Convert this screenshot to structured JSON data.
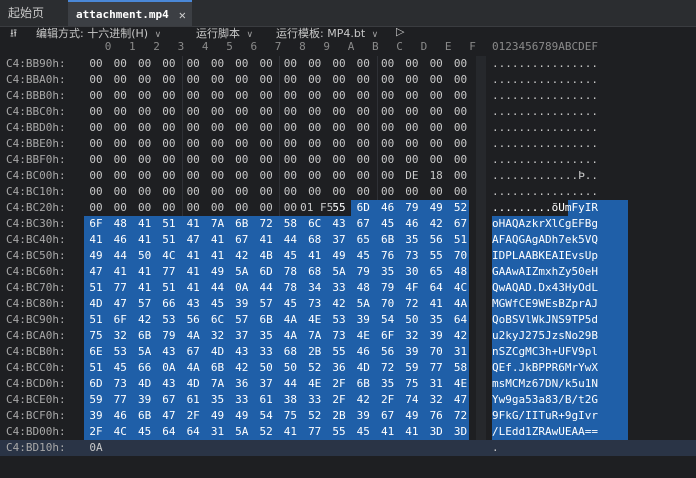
{
  "tabs": [
    {
      "label": "起始页",
      "active": false
    },
    {
      "label": "attachment.mp4",
      "active": true,
      "close": "✕"
    }
  ],
  "toolbar": {
    "pin_icon": "pin-icon",
    "edit_mode_label": "编辑方式:",
    "edit_mode_value": "十六进制(H)",
    "run_script": "运行脚本",
    "run_template_label": "运行模板:",
    "run_template_value": "MP4.bt",
    "play": "▷"
  },
  "header": {
    "columns": [
      "0",
      "1",
      "2",
      "3",
      "4",
      "5",
      "6",
      "7",
      "8",
      "9",
      "A",
      "B",
      "C",
      "D",
      "E",
      "F"
    ],
    "ascii": "0123456789ABCDEF"
  },
  "rows": [
    {
      "addr": "C4:BB90h:",
      "bytes": [
        "00",
        "00",
        "00",
        "00",
        "00",
        "00",
        "00",
        "00",
        "00",
        "00",
        "00",
        "00",
        "00",
        "00",
        "00",
        "00"
      ],
      "ascii": "................"
    },
    {
      "addr": "C4:BBA0h:",
      "bytes": [
        "00",
        "00",
        "00",
        "00",
        "00",
        "00",
        "00",
        "00",
        "00",
        "00",
        "00",
        "00",
        "00",
        "00",
        "00",
        "00"
      ],
      "ascii": "................"
    },
    {
      "addr": "C4:BBB0h:",
      "bytes": [
        "00",
        "00",
        "00",
        "00",
        "00",
        "00",
        "00",
        "00",
        "00",
        "00",
        "00",
        "00",
        "00",
        "00",
        "00",
        "00"
      ],
      "ascii": "................"
    },
    {
      "addr": "C4:BBC0h:",
      "bytes": [
        "00",
        "00",
        "00",
        "00",
        "00",
        "00",
        "00",
        "00",
        "00",
        "00",
        "00",
        "00",
        "00",
        "00",
        "00",
        "00"
      ],
      "ascii": "................"
    },
    {
      "addr": "C4:BBD0h:",
      "bytes": [
        "00",
        "00",
        "00",
        "00",
        "00",
        "00",
        "00",
        "00",
        "00",
        "00",
        "00",
        "00",
        "00",
        "00",
        "00",
        "00"
      ],
      "ascii": "................"
    },
    {
      "addr": "C4:BBE0h:",
      "bytes": [
        "00",
        "00",
        "00",
        "00",
        "00",
        "00",
        "00",
        "00",
        "00",
        "00",
        "00",
        "00",
        "00",
        "00",
        "00",
        "00"
      ],
      "ascii": "................"
    },
    {
      "addr": "C4:BBF0h:",
      "bytes": [
        "00",
        "00",
        "00",
        "00",
        "00",
        "00",
        "00",
        "00",
        "00",
        "00",
        "00",
        "00",
        "00",
        "00",
        "00",
        "00"
      ],
      "ascii": "................"
    },
    {
      "addr": "C4:BC00h:",
      "bytes": [
        "00",
        "00",
        "00",
        "00",
        "00",
        "00",
        "00",
        "00",
        "00",
        "00",
        "00",
        "00",
        "00",
        "DE",
        "18",
        "00"
      ],
      "ascii": ".............Þ.."
    },
    {
      "addr": "C4:BC10h:",
      "bytes": [
        "00",
        "00",
        "00",
        "00",
        "00",
        "00",
        "00",
        "00",
        "00",
        "00",
        "00",
        "00",
        "00",
        "00",
        "00",
        "00"
      ],
      "ascii": "................"
    },
    {
      "addr": "C4:BC20h:",
      "bytes": [
        "00",
        "00",
        "00",
        "00",
        "00",
        "00",
        "00",
        "00",
        "00",
        "01",
        "F5",
        "55",
        "6D",
        "46",
        "79",
        "49",
        "52"
      ],
      "ascii": ".........õUmFyIR"
    },
    {
      "addr": "C4:BC30h:",
      "bytes": [
        "6F",
        "48",
        "41",
        "51",
        "41",
        "7A",
        "6B",
        "72",
        "58",
        "6C",
        "43",
        "67",
        "45",
        "46",
        "42",
        "67"
      ],
      "ascii": "oHAQAzkrXlCgEFBg"
    },
    {
      "addr": "C4:BC40h:",
      "bytes": [
        "41",
        "46",
        "41",
        "51",
        "47",
        "41",
        "67",
        "41",
        "44",
        "68",
        "37",
        "65",
        "6B",
        "35",
        "56",
        "51"
      ],
      "ascii": "AFAQGAgADh7ek5VQ"
    },
    {
      "addr": "C4:BC50h:",
      "bytes": [
        "49",
        "44",
        "50",
        "4C",
        "41",
        "41",
        "42",
        "4B",
        "45",
        "41",
        "49",
        "45",
        "76",
        "73",
        "55",
        "70"
      ],
      "ascii": "IDPLAABKEAIEvsUp"
    },
    {
      "addr": "C4:BC60h:",
      "bytes": [
        "47",
        "41",
        "41",
        "77",
        "41",
        "49",
        "5A",
        "6D",
        "78",
        "68",
        "5A",
        "79",
        "35",
        "30",
        "65",
        "48"
      ],
      "ascii": "GAAwAIZmxhZy50eH"
    },
    {
      "addr": "C4:BC70h:",
      "bytes": [
        "51",
        "77",
        "41",
        "51",
        "41",
        "44",
        "0A",
        "44",
        "78",
        "34",
        "33",
        "48",
        "79",
        "4F",
        "64",
        "4C"
      ],
      "ascii": "QwAQAD.Dx43HyOdL"
    },
    {
      "addr": "C4:BC80h:",
      "bytes": [
        "4D",
        "47",
        "57",
        "66",
        "43",
        "45",
        "39",
        "57",
        "45",
        "73",
        "42",
        "5A",
        "70",
        "72",
        "41",
        "4A"
      ],
      "ascii": "MGWfCE9WEsBZprAJ"
    },
    {
      "addr": "C4:BC90h:",
      "bytes": [
        "51",
        "6F",
        "42",
        "53",
        "56",
        "6C",
        "57",
        "6B",
        "4A",
        "4E",
        "53",
        "39",
        "54",
        "50",
        "35",
        "64"
      ],
      "ascii": "QoBSVlWkJNS9TP5d"
    },
    {
      "addr": "C4:BCA0h:",
      "bytes": [
        "75",
        "32",
        "6B",
        "79",
        "4A",
        "32",
        "37",
        "35",
        "4A",
        "7A",
        "73",
        "4E",
        "6F",
        "32",
        "39",
        "42"
      ],
      "ascii": "u2kyJ275JzsNo29B"
    },
    {
      "addr": "C4:BCB0h:",
      "bytes": [
        "6E",
        "53",
        "5A",
        "43",
        "67",
        "4D",
        "43",
        "33",
        "68",
        "2B",
        "55",
        "46",
        "56",
        "39",
        "70",
        "31"
      ],
      "ascii": "nSZCgMC3h+UFV9pl"
    },
    {
      "addr": "C4:BCC0h:",
      "bytes": [
        "51",
        "45",
        "66",
        "0A",
        "4A",
        "6B",
        "42",
        "50",
        "50",
        "52",
        "36",
        "4D",
        "72",
        "59",
        "77",
        "58"
      ],
      "ascii": "QEf.JkBPPR6MrYwX"
    },
    {
      "addr": "C4:BCD0h:",
      "bytes": [
        "6D",
        "73",
        "4D",
        "43",
        "4D",
        "7A",
        "36",
        "37",
        "44",
        "4E",
        "2F",
        "6B",
        "35",
        "75",
        "31",
        "4E"
      ],
      "ascii": "msMCMz67DN/k5u1N"
    },
    {
      "addr": "C4:BCE0h:",
      "bytes": [
        "59",
        "77",
        "39",
        "67",
        "61",
        "35",
        "33",
        "61",
        "38",
        "33",
        "2F",
        "42",
        "2F",
        "74",
        "32",
        "47"
      ],
      "ascii": "Yw9ga53a83/B/t2G"
    },
    {
      "addr": "C4:BCF0h:",
      "bytes": [
        "39",
        "46",
        "6B",
        "47",
        "2F",
        "49",
        "49",
        "54",
        "75",
        "52",
        "2B",
        "39",
        "67",
        "49",
        "76",
        "72"
      ],
      "ascii": "9FkG/IITuR+9gIvr"
    },
    {
      "addr": "C4:BD00h:",
      "bytes": [
        "2F",
        "4C",
        "45",
        "64",
        "64",
        "31",
        "5A",
        "52",
        "41",
        "77",
        "55",
        "45",
        "41",
        "41",
        "3D",
        "3D"
      ],
      "ascii": "/LEdd1ZRAwUEAA=="
    },
    {
      "addr": "C4:BD10h:",
      "bytes": [
        "0A"
      ],
      "ascii": "."
    }
  ],
  "colors": {
    "selection": "#1f5fa8",
    "background": "#1e1f22",
    "text": "#c8c8c8"
  }
}
